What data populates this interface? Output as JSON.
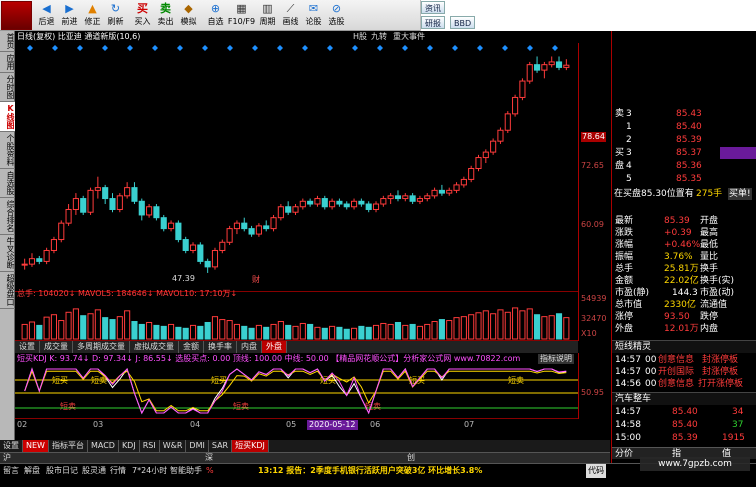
{
  "toolbar": {
    "buttons": [
      {
        "label": "后退",
        "icon": "back-arrow-icon"
      },
      {
        "label": "前进",
        "icon": "forward-arrow-icon"
      },
      {
        "label": "修正",
        "icon": "up-arrow-icon"
      },
      {
        "label": "刷新",
        "icon": "refresh-icon"
      },
      {
        "label": "买入",
        "icon": "buy-icon"
      },
      {
        "label": "卖出",
        "icon": "sell-icon"
      },
      {
        "label": "模拟",
        "icon": "simulate-icon"
      },
      {
        "label": "自选",
        "icon": "favorites-icon"
      },
      {
        "label": "F10/F9",
        "icon": "f10-icon"
      },
      {
        "label": "周期",
        "icon": "period-icon"
      },
      {
        "label": "画线",
        "icon": "draw-line-icon"
      },
      {
        "label": "论股",
        "icon": "discuss-icon"
      },
      {
        "label": "选股",
        "icon": "stock-select-icon"
      }
    ],
    "mini": [
      "资讯",
      "研报",
      "BBD"
    ]
  },
  "leftbar": [
    "首页",
    "应用",
    "分时图",
    "K线图",
    "个股资料",
    "自选股",
    "综合排名",
    "牛叉诊断",
    "超级盘口"
  ],
  "chart_header": {
    "left": "日线(复权) 比亚迪 通道新版(10,6)",
    "right_items": [
      "H股",
      "九转",
      "重大事件"
    ]
  },
  "price_axis": [
    "78.64",
    "72.65",
    "60.09"
  ],
  "price_low_label": "47.39",
  "event_label": "财",
  "volume_header": "总手: 104020↓ MAVOL5: 184646↓ MAVOL10: 17:10万↓",
  "volume_axis": [
    "54939",
    "32470",
    "X10"
  ],
  "indicator_tabs": [
    "设置",
    "成交量",
    "多周期成交量",
    "虚拟成交量",
    "金额",
    "换手率",
    "内盘",
    "外盘"
  ],
  "kdj_header": "短买KDJ K: 93.74↓ D: 97.34↓ J: 86.55↓ 选股买点: 0.00 顶线: 100.00 中线: 50.00 【精品网花顺公式】分析家公式网 www.70822.com",
  "kdj_explain": "指标说明",
  "kdj_axis": [
    "50.95"
  ],
  "kdj_markers": {
    "buy": "短买",
    "sell": "短卖"
  },
  "date_axis": [
    "02",
    "03",
    "04",
    "05",
    "2020-05-12",
    "06",
    "07"
  ],
  "bottom_tabs": [
    "设置",
    "NEW",
    "指标平台",
    "MACD",
    "KDJ",
    "RSI",
    "W&R",
    "DMI",
    "SAR",
    "短买KDJ"
  ],
  "index_bar": [
    "沪",
    "深",
    "创"
  ],
  "order_book": [
    {
      "side": "卖",
      "level": "3",
      "price": "85.43"
    },
    {
      "side": "",
      "level": "1",
      "price": "85.40"
    },
    {
      "side": "",
      "level": "2",
      "price": "85.39"
    },
    {
      "side": "买",
      "level": "3",
      "price": "85.37"
    },
    {
      "side": "盘",
      "level": "4",
      "price": "85.36"
    },
    {
      "side": "",
      "level": "5",
      "price": "85.35"
    }
  ],
  "sell_axis_label": "78.64",
  "order_summary": {
    "left": "在买盘85.30位置有",
    "qty": "275手",
    "right": "买单!"
  },
  "quote_rows": [
    {
      "l1": "最新",
      "v1": "85.39",
      "l2": "开盘",
      "v2": ""
    },
    {
      "l1": "涨跌",
      "v1": "+0.39",
      "l2": "最高",
      "v2": ""
    },
    {
      "l1": "涨幅",
      "v1": "+0.46%",
      "l2": "最低",
      "v2": ""
    },
    {
      "l1": "振幅",
      "v1": "3.76%",
      "l2": "量比",
      "v2": ""
    },
    {
      "l1": "总手",
      "v1": "25.81万",
      "l2": "换手",
      "v2": ""
    },
    {
      "l1": "金额",
      "v1": "22.02亿",
      "l2": "换手(实)",
      "v2": ""
    },
    {
      "l1": "市盈(静)",
      "v1": "144.3",
      "l2": "市盈(动)",
      "v2": ""
    },
    {
      "l1": "总市值",
      "v1": "2330亿",
      "l2": "流通值",
      "v2": ""
    },
    {
      "l1": "涨停",
      "v1": "93.50",
      "l2": "跌停",
      "v2": ""
    },
    {
      "l1": "外盘",
      "v1": "12.01万",
      "l2": "内盘",
      "v2": ""
    }
  ],
  "news_title": "短线精灵",
  "news": [
    {
      "time": "14:57",
      "code": "00",
      "text": "创意信息",
      "tag": "封涨停板"
    },
    {
      "time": "14:57",
      "code": "00",
      "text": "开创国际",
      "tag": "封涨停板"
    },
    {
      "time": "14:56",
      "code": "00",
      "text": "创意信息",
      "tag": "打开涨停板"
    }
  ],
  "sector_title": "汽车整车",
  "ticks": [
    {
      "time": "14:57",
      "price": "85.40",
      "vol": "34"
    },
    {
      "time": "14:58",
      "price": "85.40",
      "vol": "37"
    },
    {
      "time": "15:00",
      "price": "85.39",
      "vol": "1915"
    }
  ],
  "right_tabs": [
    "分价",
    "指",
    "值"
  ],
  "statusbar": {
    "items": [
      "留言",
      "解盘",
      "股市日记",
      "股灵通",
      "行情",
      "7*24小时",
      "智能助手",
      "%"
    ],
    "ticker": "13:12 报告：2季度手机银行活跃用户突破3亿 环比增长3.8%",
    "search": "代码"
  },
  "watermark": "www.7gpzb.com",
  "chart_data": {
    "type": "candlestick",
    "series": [
      {
        "name": "比亚迪",
        "ohlc": [
          [
            49,
            50,
            48,
            49
          ],
          [
            49,
            51,
            48.5,
            50
          ],
          [
            50,
            50.5,
            49,
            49.5
          ],
          [
            49.5,
            52,
            49,
            51.5
          ],
          [
            51.5,
            54,
            51,
            53.5
          ],
          [
            53.5,
            57,
            53,
            56.5
          ],
          [
            56.5,
            60,
            56,
            59
          ],
          [
            59,
            62,
            58,
            61
          ],
          [
            61,
            61.5,
            58,
            58.5
          ],
          [
            58.5,
            63,
            58,
            62.5
          ],
          [
            62.5,
            65,
            61,
            63
          ],
          [
            63,
            63.5,
            60,
            61
          ],
          [
            61,
            62,
            58.5,
            59
          ],
          [
            59,
            62,
            58.5,
            61.5
          ],
          [
            61.5,
            64,
            61,
            63
          ],
          [
            63,
            64,
            60,
            60.5
          ],
          [
            60.5,
            61,
            57,
            58
          ],
          [
            58,
            60,
            57.5,
            59.5
          ],
          [
            59.5,
            60,
            57,
            57.5
          ],
          [
            57.5,
            58,
            55,
            55.5
          ],
          [
            55.5,
            57,
            55,
            56.5
          ],
          [
            56.5,
            57,
            53,
            53.5
          ],
          [
            53.5,
            54,
            51,
            51.5
          ],
          [
            51.5,
            53,
            51,
            52.5
          ],
          [
            52.5,
            53,
            49,
            49.5
          ],
          [
            49.5,
            50,
            47.39,
            48.5
          ],
          [
            48.5,
            52,
            48,
            51.5
          ],
          [
            51.5,
            53.5,
            51,
            53
          ],
          [
            53,
            56,
            52.5,
            55.5
          ],
          [
            55.5,
            57,
            54.5,
            56.5
          ],
          [
            56.5,
            57.5,
            55,
            55.5
          ],
          [
            55.5,
            56,
            54,
            54.5
          ],
          [
            54.5,
            56.5,
            54,
            56
          ],
          [
            56,
            57,
            55,
            55.5
          ],
          [
            55.5,
            58,
            55,
            57.5
          ],
          [
            57.5,
            60,
            57,
            59.5
          ],
          [
            59.5,
            60.5,
            58,
            58.5
          ],
          [
            58.5,
            60,
            58,
            59.5
          ],
          [
            59.5,
            61,
            59,
            60.5
          ],
          [
            60.5,
            61,
            59.5,
            60
          ],
          [
            60,
            61.5,
            59.5,
            61
          ],
          [
            61,
            61.5,
            59,
            59.5
          ],
          [
            59.5,
            61,
            59,
            60.5
          ],
          [
            60.5,
            61,
            59.5,
            60
          ],
          [
            60,
            60.5,
            59,
            59.5
          ],
          [
            59.5,
            61,
            59,
            60.5
          ],
          [
            60.5,
            61,
            59.5,
            60
          ],
          [
            60,
            60.5,
            58.5,
            59
          ],
          [
            59,
            60.5,
            58.5,
            60
          ],
          [
            60,
            61.5,
            59.5,
            61
          ],
          [
            61,
            62,
            60,
            61.5
          ],
          [
            61.5,
            62.5,
            60.5,
            61
          ],
          [
            61,
            62,
            60.5,
            61.5
          ],
          [
            61.5,
            62,
            60,
            60.5
          ],
          [
            60.5,
            61.5,
            60,
            61
          ],
          [
            61,
            62,
            60.5,
            61.5
          ],
          [
            61.5,
            63,
            61,
            62.5
          ],
          [
            62.5,
            63.5,
            61.5,
            62
          ],
          [
            62,
            63,
            61.5,
            62.5
          ],
          [
            62.5,
            64,
            62,
            63.5
          ],
          [
            63.5,
            65,
            63,
            64.5
          ],
          [
            64.5,
            67,
            64,
            66.5
          ],
          [
            66.5,
            69,
            66,
            68.5
          ],
          [
            68.5,
            70,
            67.5,
            69.5
          ],
          [
            69.5,
            72,
            69,
            71.5
          ],
          [
            71.5,
            74,
            71,
            73.5
          ],
          [
            73.5,
            77,
            73,
            76.5
          ],
          [
            76.5,
            80,
            76,
            79.5
          ],
          [
            79.5,
            83,
            79,
            82.5
          ],
          [
            82.5,
            86,
            82,
            85.5
          ],
          [
            85.5,
            87,
            84,
            84.5
          ],
          [
            84.5,
            86,
            83,
            85.5
          ],
          [
            85.5,
            87,
            85,
            86
          ],
          [
            86,
            87,
            84.5,
            85
          ],
          [
            85,
            86.5,
            84.5,
            85.4
          ]
        ]
      }
    ],
    "ylim": [
      45,
      88
    ],
    "volume": [
      30,
      35,
      28,
      45,
      50,
      38,
      55,
      62,
      48,
      52,
      60,
      44,
      40,
      46,
      58,
      36,
      30,
      34,
      28,
      26,
      30,
      24,
      22,
      28,
      26,
      34,
      46,
      40,
      38,
      30,
      26,
      22,
      28,
      24,
      30,
      36,
      28,
      26,
      32,
      30,
      24,
      22,
      26,
      24,
      20,
      22,
      26,
      24,
      28,
      32,
      30,
      34,
      28,
      30,
      26,
      30,
      36,
      40,
      38,
      44,
      46,
      50,
      54,
      58,
      52,
      60,
      55,
      64,
      58,
      62,
      50,
      46,
      48,
      52,
      44
    ],
    "kdj": {
      "K": 93.74,
      "D": 97.34,
      "J": 86.55
    }
  }
}
